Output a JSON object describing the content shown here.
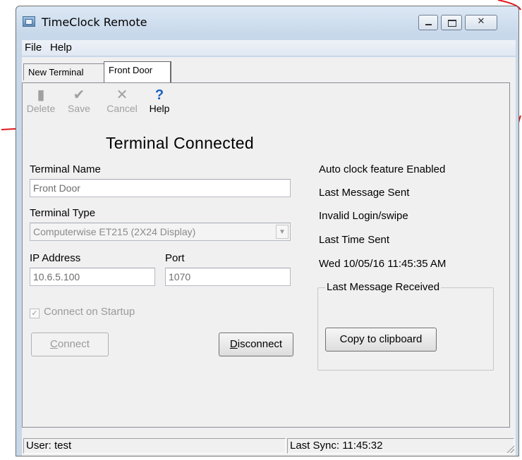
{
  "window": {
    "title": "TimeClock Remote",
    "close_glyph": "✕"
  },
  "menu": {
    "file": "File",
    "help": "Help"
  },
  "tabs": [
    {
      "label": "New Terminal"
    },
    {
      "label": "Front Door"
    }
  ],
  "toolbar": {
    "delete": {
      "label": "Delete",
      "icon": "trash-icon",
      "glyph": "▮"
    },
    "save": {
      "label": "Save",
      "icon": "checkmark-icon",
      "glyph": "✔"
    },
    "cancel": {
      "label": "Cancel",
      "icon": "x-icon",
      "glyph": "✕"
    },
    "help": {
      "label": "Help",
      "icon": "question-icon",
      "glyph": "?"
    }
  },
  "status_heading": "Terminal Connected",
  "form": {
    "terminal_name_label": "Terminal Name",
    "terminal_name_value": "Front Door",
    "terminal_type_label": "Terminal Type",
    "terminal_type_value": "Computerwise ET215 (2X24 Display)",
    "combo_arrow": "▼",
    "ip_label": "IP Address",
    "ip_value": "10.6.5.100",
    "port_label": "Port",
    "port_value": "1070",
    "connect_on_startup_label": "Connect on Startup",
    "connect_on_startup_checked": true,
    "check_glyph": "✓",
    "connect_button_first": "C",
    "connect_button_rest": "onnect",
    "disconnect_button_first": "D",
    "disconnect_button_rest": "isconnect"
  },
  "info": {
    "auto_clock": "Auto clock feature Enabled",
    "last_message_sent_label": "Last Message Sent",
    "last_message_sent_value": "Invalid Login/swipe",
    "last_time_sent_label": "Last Time Sent",
    "last_time_sent_value": "Wed 10/05/16 11:45:35 AM",
    "last_message_received_label": "Last Message Received",
    "copy_button": "Copy to clipboard"
  },
  "statusbar": {
    "user": "User: test",
    "last_sync": "Last Sync: 11:45:32"
  },
  "colors": {
    "annotation": "#e0191c",
    "help_icon": "#1a5fc2"
  }
}
